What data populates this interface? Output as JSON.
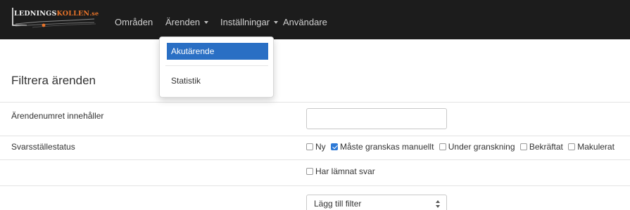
{
  "brand": {
    "name_part1": "LEDNINGS",
    "name_part2": "KOLLEN",
    "name_part3": ".se",
    "accent_color": "#e8742a"
  },
  "nav": {
    "items": [
      {
        "label": "Områden",
        "has_caret": false
      },
      {
        "label": "Ärenden",
        "has_caret": true,
        "open": true
      },
      {
        "label": "Inställningar",
        "has_caret": true
      },
      {
        "label": "Användare",
        "has_caret": false
      }
    ]
  },
  "dropdown": {
    "items": [
      {
        "label": "Akutärende",
        "active": true
      },
      {
        "label": "Statistik",
        "active": false
      }
    ],
    "active_color": "#2a6fc4"
  },
  "page": {
    "title": "Filtrera ärenden"
  },
  "filters": {
    "case_number": {
      "label": "Ärendenumret innehåller",
      "value": ""
    },
    "status": {
      "label": "Svarsställestatus",
      "options": [
        {
          "label": "Ny",
          "checked": false
        },
        {
          "label": "Måste granskas manuellt",
          "checked": true
        },
        {
          "label": "Under granskning",
          "checked": false
        },
        {
          "label": "Bekräftat",
          "checked": false
        },
        {
          "label": "Makulerat",
          "checked": false
        }
      ],
      "extra_option": {
        "label": "Har lämnat svar",
        "checked": false
      }
    },
    "add_filter": {
      "selected": "Lägg till filter"
    }
  }
}
